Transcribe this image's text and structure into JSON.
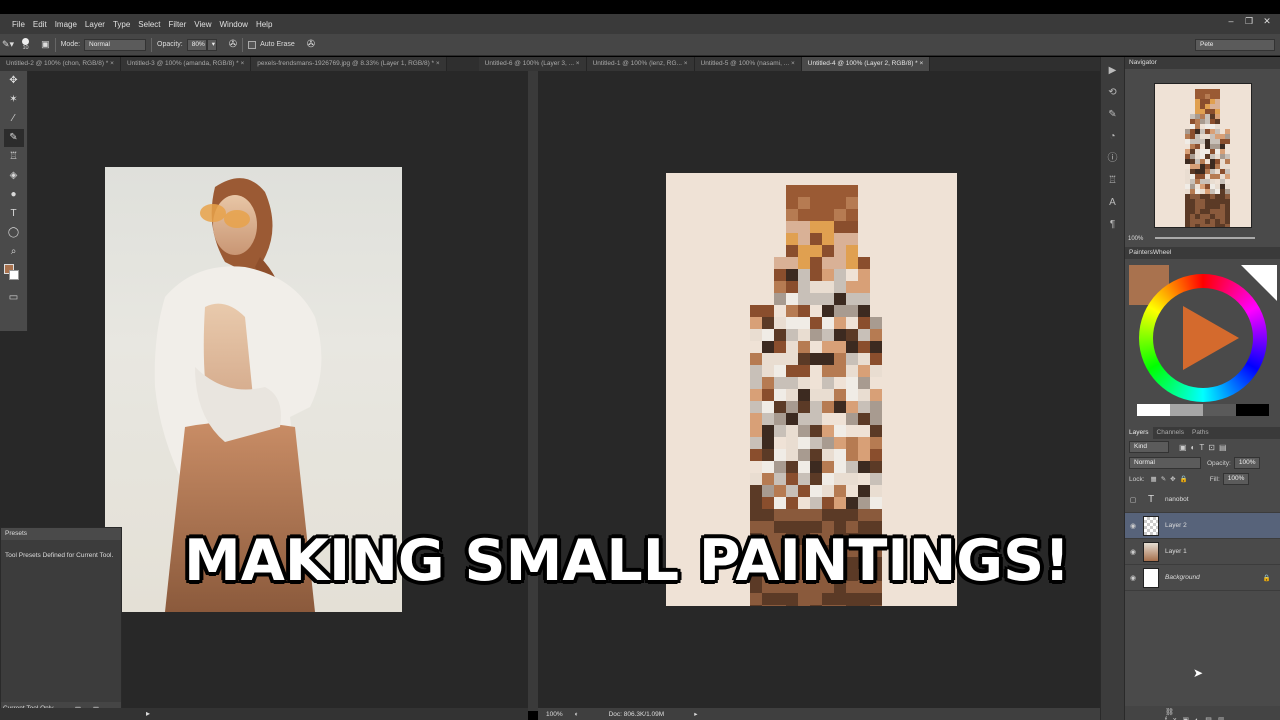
{
  "menu": [
    "File",
    "Edit",
    "Image",
    "Layer",
    "Type",
    "Select",
    "Filter",
    "View",
    "Window",
    "Help"
  ],
  "window_buttons": [
    "–",
    "❐",
    "✕"
  ],
  "options": {
    "brush_size": "10",
    "mode_label": "Mode:",
    "mode_value": "Normal",
    "opacity_label": "Opacity:",
    "opacity_value": "80%",
    "auto_erase": "Auto Erase",
    "workspace": "Pete"
  },
  "tabs": [
    "Untitled-2 @ 100% (chon, RGB/8) * ×",
    "Untitled-3 @ 100% (amanda, RGB/8) * ×",
    "pexels-frendsmans-1926769.jpg @ 8.33% (Layer 1, RGB/8) * ×",
    "Untitled-6 @ 100% (Layer 3, ... ×",
    "Untitled-1 @ 100% (lenz, RG... ×",
    "Untitled-5 @ 100% (nasami, ... ×",
    "Untitled-4 @ 100% (Layer 2, RGB/8) * ×"
  ],
  "presets": {
    "title": "Presets",
    "message": "Tool Presets Defined for Current Tool.",
    "footer": "Current Tool Only"
  },
  "status": {
    "zoom": "100%",
    "doc": "Doc: 806.3K/1.09M"
  },
  "navigator": {
    "title": "Navigator",
    "zoom": "100%"
  },
  "color_panel": {
    "title": "PaintersWheel",
    "swatches": [
      "#ffffff",
      "#a6a6a6",
      "#5a5a5a",
      "#000000"
    ]
  },
  "layers": {
    "tabs": [
      "Layers",
      "Channels",
      "Paths"
    ],
    "kind": "Kind",
    "blend": "Normal",
    "opacity_label": "Opacity:",
    "opacity_value": "100%",
    "lock_label": "Lock:",
    "fill_label": "Fill:",
    "fill_value": "100%",
    "rows": [
      {
        "name": "nanobot",
        "type": "text"
      },
      {
        "name": "Layer 2",
        "type": "layer"
      },
      {
        "name": "Layer 1",
        "type": "layer"
      },
      {
        "name": "Background",
        "type": "background"
      }
    ]
  },
  "overlay_title": "MAKING SMALL PAINTINGS!"
}
